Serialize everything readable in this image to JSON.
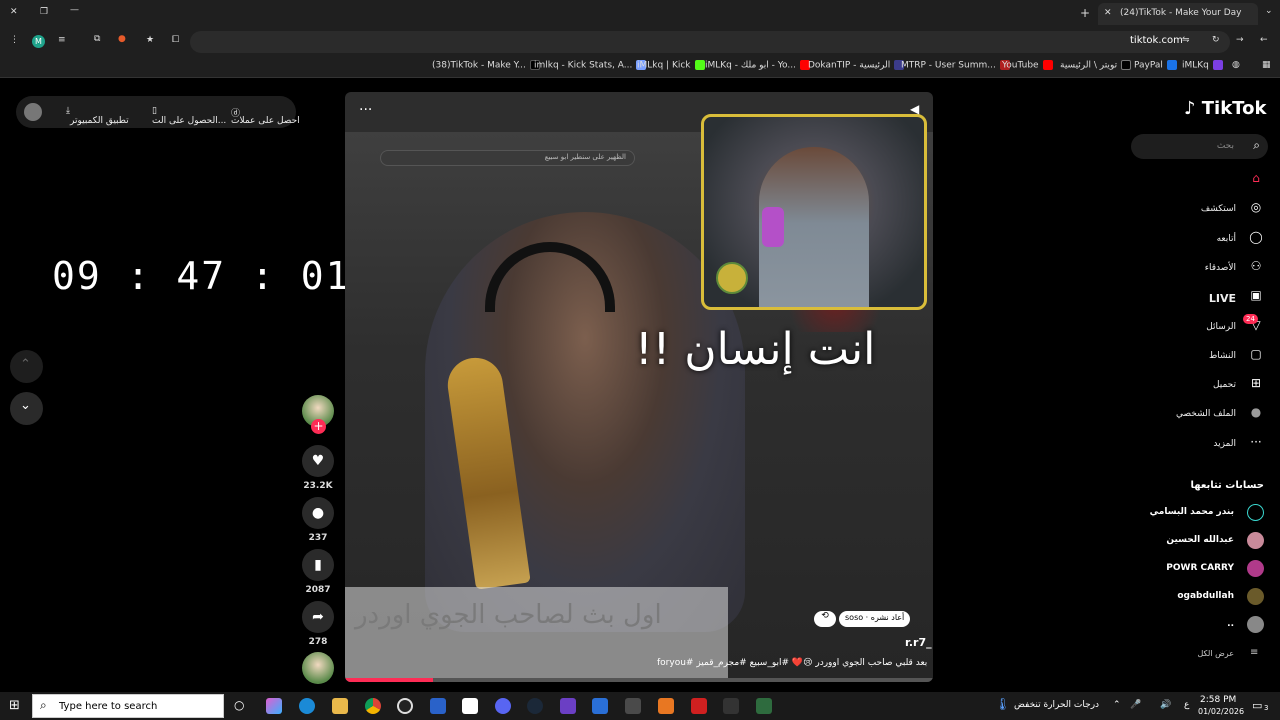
{
  "browser": {
    "tab_active_title": "(24)TikTok - Make Your Day",
    "url": "tiktok.com",
    "bookmarks": [
      "(38)TikTok - Make Y...",
      "imlkq - Kick Stats, A...",
      "iMLkq | Kick",
      "iMLKq - ابو ملك - Yo...",
      "DokanTIP - الرئيسية",
      "MTRP - User Summ...",
      "YouTube",
      "تويتر \\ الرئيسية",
      "PayPal",
      "iMLKq"
    ]
  },
  "top_pill": {
    "coins": "احصل على عملات",
    "get_app": "الحصول على الت...",
    "desktop_app": "تطبيق الكمبيوتر"
  },
  "clock": "09 : 47 : 01",
  "video": {
    "overlay_text": "انت إنسان !!",
    "bottom_caption": "اول بث لصاحب الجوي اوردر",
    "search_strip": "الظهير على سنطير ابو سبيع",
    "repost_label": "أعاد نشره",
    "repost_user": "soso",
    "author": "r.r7_",
    "description": "بعد قلبي صاحب الجوي اووردر 😢❤️ #ابو_سبيع #مجرم_قميز #foryou",
    "progress_fraction": 0.15
  },
  "actions": {
    "likes": "23.2K",
    "comments": "237",
    "saves": "2087",
    "shares": "278"
  },
  "sidebar": {
    "logo": "TikTok",
    "search_placeholder": "بحث",
    "nav": [
      {
        "label": "",
        "icon": "home-icon"
      },
      {
        "label": "استكشف",
        "icon": "compass-icon"
      },
      {
        "label": "أتابعه",
        "icon": "following-icon"
      },
      {
        "label": "الأصدقاء",
        "icon": "friends-icon"
      },
      {
        "label": "LIVE",
        "icon": "live-icon"
      },
      {
        "label": "الرسائل",
        "icon": "messages-icon",
        "badge": "24"
      },
      {
        "label": "النشاط",
        "icon": "activity-icon"
      },
      {
        "label": "تحميل",
        "icon": "upload-icon"
      },
      {
        "label": "الملف الشخصي",
        "icon": "profile-icon"
      },
      {
        "label": "المزيد",
        "icon": "more-icon"
      }
    ],
    "following_title": "حسابات تتابعها",
    "following": [
      "بندر محمد البسامي",
      "عبدالله الحسين",
      "POWR CARRY",
      "ogabdullah",
      ".."
    ],
    "see_all": "عرض الكل"
  },
  "taskbar": {
    "search_placeholder": "Type here to search",
    "weather": "درجات الحرارة تنخفض",
    "time": "2:58 PM",
    "date": "01/02/2026",
    "lang": "ع",
    "notif_count": "3"
  }
}
